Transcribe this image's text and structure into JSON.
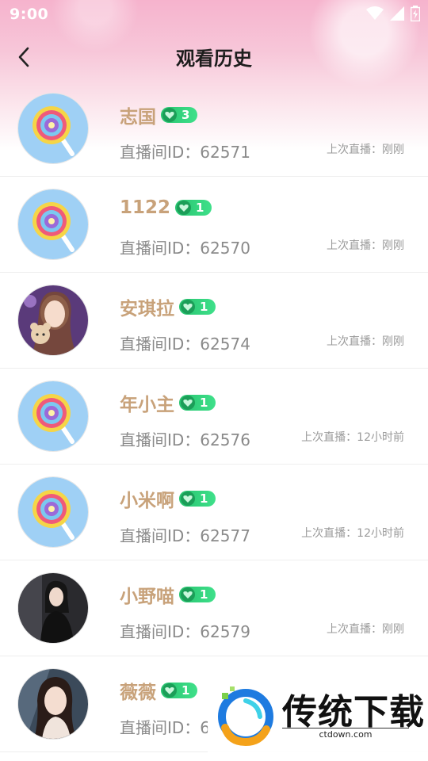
{
  "status_bar": {
    "time": "9:00"
  },
  "header": {
    "title": "观看历史"
  },
  "history": [
    {
      "name": "志国",
      "level": "3",
      "room_id": "直播间ID：62571",
      "last_live": "上次直播：刚刚",
      "avatar": "lollipop"
    },
    {
      "name": "1122",
      "level": "1",
      "room_id": "直播间ID：62570",
      "last_live": "上次直播：刚刚",
      "avatar": "lollipop"
    },
    {
      "name": "安琪拉",
      "level": "1",
      "room_id": "直播间ID：62574",
      "last_live": "上次直播：刚刚",
      "avatar": "photo-girl-teddy"
    },
    {
      "name": "年小主",
      "level": "1",
      "room_id": "直播间ID：62576",
      "last_live": "上次直播：12小时前",
      "avatar": "lollipop"
    },
    {
      "name": "小米啊",
      "level": "1",
      "room_id": "直播间ID：62577",
      "last_live": "上次直播：12小时前",
      "avatar": "lollipop"
    },
    {
      "name": "小野喵",
      "level": "1",
      "room_id": "直播间ID：62579",
      "last_live": "上次直播：刚刚",
      "avatar": "photo-girl-dark"
    },
    {
      "name": "薇薇",
      "level": "1",
      "room_id": "直播间ID：6",
      "last_live": "",
      "avatar": "photo-girl-light"
    }
  ],
  "watermark": {
    "brand": "传统下载",
    "url": "ctdown.com"
  },
  "colors": {
    "name": "#c8a27a",
    "badge": "#2fd07a",
    "header_pink": "#f6b3cd",
    "avatar_bg": "#9fd0f5"
  }
}
